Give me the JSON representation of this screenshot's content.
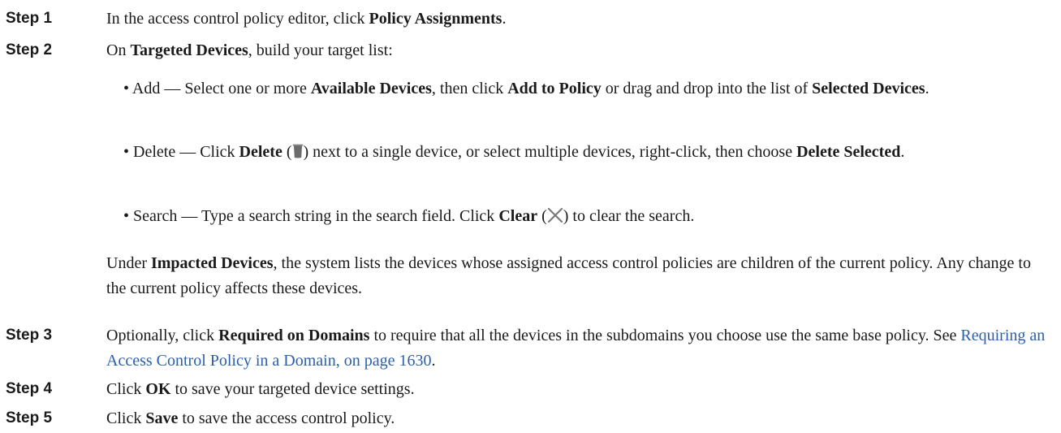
{
  "steps": {
    "s1": {
      "label": "Step 1",
      "pre": "In the access control policy editor, click ",
      "bold": "Policy Assignments",
      "post": "."
    },
    "s2": {
      "label": "Step 2",
      "pre": "On ",
      "bold": "Targeted Devices",
      "post": ", build your target list:",
      "bullets": {
        "add": {
          "lead": "• Add — Select one or more ",
          "b1": "Available Devices",
          "m1": ", then click ",
          "b2": "Add to Policy",
          "m2": " or drag and drop into the list of ",
          "b3": "Selected Devices",
          "end": "."
        },
        "delete": {
          "lead": "• Delete — Click ",
          "b1": "Delete",
          "open": " (",
          "close": ") next to a single device, or select multiple devices, right-click, then choose ",
          "b2": "Delete Selected",
          "end": "."
        },
        "search": {
          "lead": "• Search — Type a search string in the search field. Click ",
          "b1": "Clear",
          "open": " (",
          "close": ") to clear the search."
        }
      },
      "note": {
        "pre": "Under ",
        "bold": "Impacted Devices",
        "post": ", the system lists the devices whose assigned access control policies are children of the current policy. Any change to the current policy affects these devices."
      }
    },
    "s3": {
      "label": "Step 3",
      "pre": "Optionally, click ",
      "bold": "Required on Domains",
      "post": " to require that all the devices in the subdomains you choose use the same base policy. See ",
      "link": "Requiring an Access Control Policy in a Domain, on page 1630",
      "end": "."
    },
    "s4": {
      "label": "Step 4",
      "pre": "Click ",
      "bold": "OK",
      "post": " to save your targeted device settings."
    },
    "s5": {
      "label": "Step 5",
      "pre": "Click ",
      "bold": "Save",
      "post": " to save the access control policy."
    }
  },
  "icons": {
    "delete": "trash-icon",
    "clear": "close-icon"
  },
  "colors": {
    "text": "#1a1a1a",
    "link": "#2d5fa8",
    "icon": "#6b6b6b"
  }
}
